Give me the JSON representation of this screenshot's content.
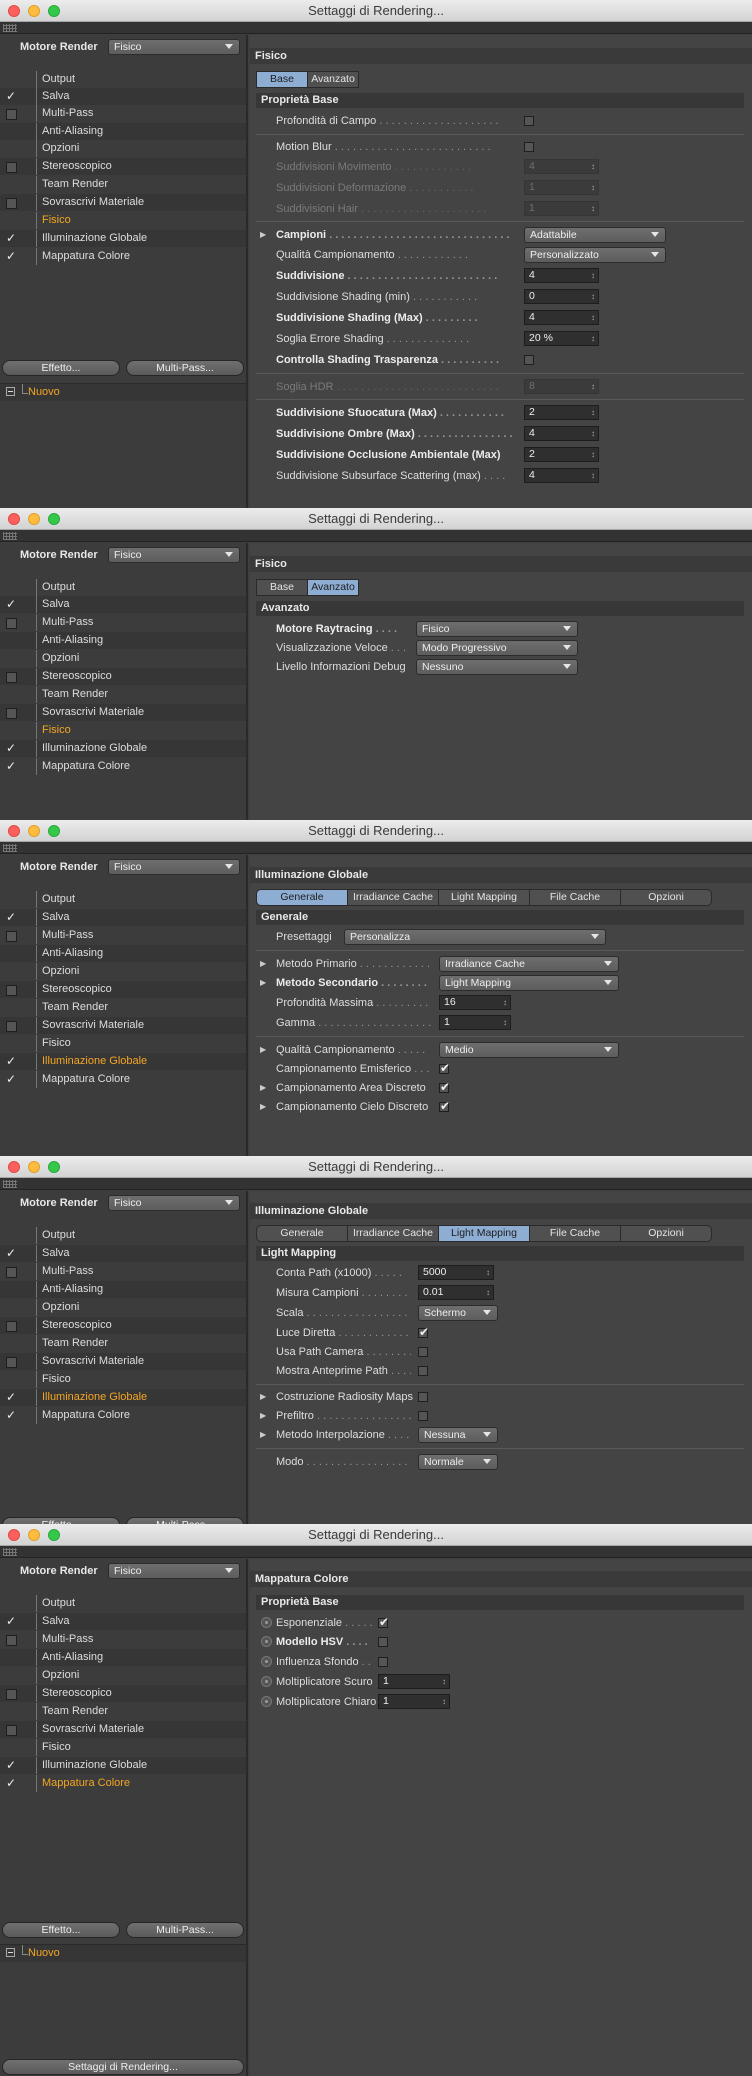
{
  "window_title": "Settaggi di Rendering...",
  "motore_label": "Motore Render",
  "motore_value": "Fisico",
  "buttons": {
    "effetto": "Effetto...",
    "multipass": "Multi-Pass..."
  },
  "nuovo": "Nuovo",
  "bottom_button": "Settaggi di Rendering...",
  "left_items": [
    {
      "label": "Output"
    },
    {
      "label": "Salva"
    },
    {
      "label": "Multi-Pass"
    },
    {
      "label": "Anti-Aliasing"
    },
    {
      "label": "Opzioni"
    },
    {
      "label": "Stereoscopico"
    },
    {
      "label": "Team Render"
    },
    {
      "label": "Sovrascrivi Materiale"
    },
    {
      "label": "Fisico"
    },
    {
      "label": "Illuminazione Globale"
    },
    {
      "label": "Mappatura Colore"
    }
  ],
  "w1": {
    "header": "Fisico",
    "tabs": [
      "Base",
      "Avanzato"
    ],
    "section": "Proprietà Base",
    "rows": [
      {
        "label": "Profondità di Campo",
        "value": ""
      },
      {
        "label": "Motion Blur",
        "value": ""
      },
      {
        "label": "Suddivisioni Movimento",
        "value": "4"
      },
      {
        "label": "Suddivisioni Deformazione",
        "value": "1"
      },
      {
        "label": "Suddivisioni Hair",
        "value": "1"
      },
      {
        "label": "Campioni",
        "value": "Adattabile"
      },
      {
        "label": "Qualità Campionamento",
        "value": "Personalizzato"
      },
      {
        "label": "Suddivisione",
        "value": "4"
      },
      {
        "label": "Suddivisione Shading (min)",
        "value": "0"
      },
      {
        "label": "Suddivisione Shading (Max)",
        "value": "4"
      },
      {
        "label": "Soglia Errore Shading",
        "value": "20 %"
      },
      {
        "label": "Controlla Shading Trasparenza",
        "value": ""
      },
      {
        "label": "Soglia HDR",
        "value": "8"
      },
      {
        "label": "Suddivisione Sfuocatura (Max)",
        "value": "2"
      },
      {
        "label": "Suddivisione Ombre (Max)",
        "value": "4"
      },
      {
        "label": "Suddivisione Occlusione Ambientale (Max)",
        "value": "2"
      },
      {
        "label": "Suddivisione Subsurface Scattering (max)",
        "value": "4"
      }
    ]
  },
  "w2": {
    "header": "Fisico",
    "tabs": [
      "Base",
      "Avanzato"
    ],
    "section": "Avanzato",
    "rows": [
      {
        "label": "Motore Raytracing",
        "value": "Fisico"
      },
      {
        "label": "Visualizzazione Veloce",
        "value": "Modo Progressivo"
      },
      {
        "label": "Livello Informazioni Debug",
        "value": "Nessuno"
      }
    ]
  },
  "w3": {
    "header": "Illuminazione Globale",
    "tabs": [
      "Generale",
      "Irradiance Cache",
      "Light Mapping",
      "File Cache",
      "Opzioni"
    ],
    "section": "Generale",
    "rows": [
      {
        "label": "Presettaggi",
        "value": "Personalizza"
      },
      {
        "label": "Metodo Primario",
        "value": "Irradiance Cache"
      },
      {
        "label": "Metodo Secondario",
        "value": "Light Mapping"
      },
      {
        "label": "Profondità Massima",
        "value": "16"
      },
      {
        "label": "Gamma",
        "value": "1"
      },
      {
        "label": "Qualità Campionamento",
        "value": "Medio"
      },
      {
        "label": "Campionamento Emisferico",
        "value": ""
      },
      {
        "label": "Campionamento Area Discreto",
        "value": ""
      },
      {
        "label": "Campionamento Cielo Discreto",
        "value": ""
      }
    ]
  },
  "w4": {
    "header": "Illuminazione Globale",
    "tabs": [
      "Generale",
      "Irradiance Cache",
      "Light Mapping",
      "File Cache",
      "Opzioni"
    ],
    "section": "Light Mapping",
    "rows": [
      {
        "label": "Conta Path (x1000)",
        "value": "5000"
      },
      {
        "label": "Misura Campioni",
        "value": "0.01"
      },
      {
        "label": "Scala",
        "value": "Schermo"
      },
      {
        "label": "Luce Diretta",
        "value": ""
      },
      {
        "label": "Usa Path Camera",
        "value": ""
      },
      {
        "label": "Mostra Anteprime Path",
        "value": ""
      },
      {
        "label": "Costruzione Radiosity Maps",
        "value": ""
      },
      {
        "label": "Prefiltro",
        "value": ""
      },
      {
        "label": "Metodo Interpolazione",
        "value": "Nessuna"
      },
      {
        "label": "Modo",
        "value": "Normale"
      }
    ]
  },
  "w5": {
    "header": "Mappatura Colore",
    "section": "Proprietà Base",
    "rows": [
      {
        "label": "Esponenziale",
        "value": ""
      },
      {
        "label": "Modello HSV",
        "value": ""
      },
      {
        "label": "Influenza Sfondo",
        "value": ""
      },
      {
        "label": "Moltiplicatore Scuro",
        "value": "1"
      },
      {
        "label": "Moltiplicatore Chiaro",
        "value": "1"
      }
    ]
  }
}
